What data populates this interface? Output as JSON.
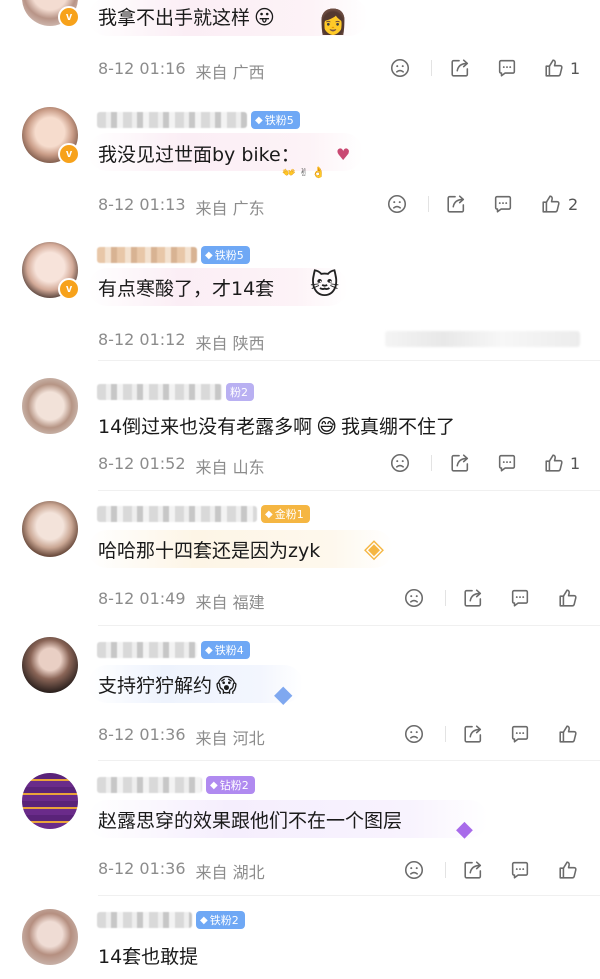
{
  "colors": {
    "accent_orange": "#f7a21b",
    "fan_iron": "#6fa8f5",
    "fan_gold": "#f5b642",
    "fan_diamond": "#b08af0",
    "meta_gray": "#8c8c8c",
    "icon_gray": "#6b6b6b"
  },
  "comments": [
    {
      "text": "我拿不出手就这样",
      "emoji": "😛",
      "time": "8-12 01:16",
      "from": "来自 广西",
      "likes": "1",
      "fan_badge": "",
      "verified": "v"
    },
    {
      "text": "我没见过世面by bike：",
      "emoji": "",
      "time": "8-12 01:13",
      "from": "来自 广东",
      "likes": "2",
      "fan_badge": "铁粉5",
      "verified": "v"
    },
    {
      "text": "有点寒酸了，才14套",
      "emoji": "",
      "time": "8-12 01:12",
      "from": "来自 陕西",
      "likes": "",
      "fan_badge": "铁粉5",
      "verified": "v"
    },
    {
      "text": "14倒过来也没有老露多啊",
      "text_after": "我真绷不住了",
      "emoji": "😅",
      "time": "8-12 01:52",
      "from": "来自 山东",
      "likes": "1",
      "fan_badge": "粉2",
      "verified": ""
    },
    {
      "text": "哈哈那十四套还是因为zyk",
      "emoji": "",
      "time": "8-12 01:49",
      "from": "来自 福建",
      "likes": "",
      "fan_badge": "金粉1",
      "verified": ""
    },
    {
      "text": "支持狞狞解约",
      "emoji": "😱",
      "time": "8-12 01:36",
      "from": "来自 河北",
      "likes": "",
      "fan_badge": "铁粉4",
      "verified": ""
    },
    {
      "text": "赵露思穿的效果跟他们不在一个图层",
      "emoji": "",
      "time": "8-12 01:36",
      "from": "来自 湖北",
      "likes": "",
      "fan_badge": "钻粉2",
      "verified": ""
    },
    {
      "text": "14套也敢提",
      "emoji": "",
      "time": "",
      "from": "",
      "likes": "",
      "fan_badge": "铁粉2",
      "verified": ""
    }
  ],
  "icons": {
    "dislike": "frown-icon",
    "share": "share-icon",
    "comment": "comment-icon",
    "like": "thumbs-up-icon"
  }
}
